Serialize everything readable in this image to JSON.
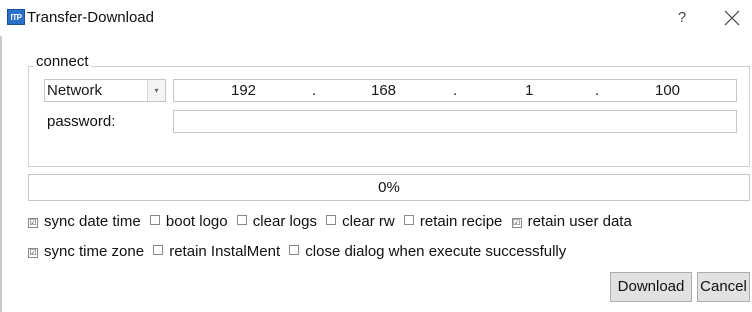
{
  "window": {
    "icon_text": "ITP",
    "title": "Transfer-Download",
    "help_label": "?"
  },
  "connect": {
    "group_label": "connect",
    "connection_type": "Network",
    "ip": [
      "192",
      ".",
      "168",
      ".",
      "1",
      ".",
      "100"
    ],
    "password_label": "password:",
    "password_value": ""
  },
  "progress": {
    "percent": 0,
    "text": "0%"
  },
  "options_row1": [
    {
      "label": "sync date time",
      "checked": true,
      "mark": "☑"
    },
    {
      "label": "boot logo",
      "checked": false,
      "mark": ""
    },
    {
      "label": "clear logs",
      "checked": false,
      "mark": ""
    },
    {
      "label": "clear rw",
      "checked": false,
      "mark": ""
    },
    {
      "label": "retain recipe",
      "checked": false,
      "mark": ""
    },
    {
      "label": "retain user data",
      "checked": true,
      "mark": "☑"
    }
  ],
  "options_row2": [
    {
      "label": "sync time zone",
      "checked": true,
      "mark": "☑"
    },
    {
      "label": "retain InstalMent",
      "checked": false,
      "mark": ""
    },
    {
      "label": "close dialog when execute successfully",
      "checked": false,
      "mark": ""
    }
  ],
  "buttons": {
    "download": "Download",
    "cancel": "Cancel"
  }
}
